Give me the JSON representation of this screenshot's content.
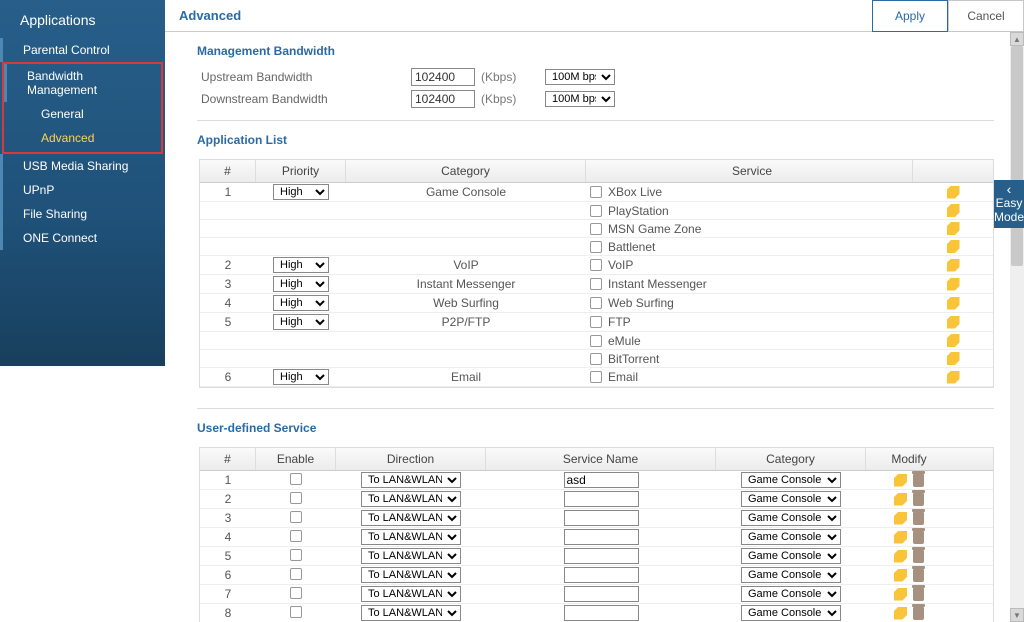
{
  "sidebar": {
    "title": "Applications",
    "items": [
      {
        "label": "Parental Control"
      },
      {
        "label": "Bandwidth Management"
      },
      {
        "label": "General",
        "sub": true
      },
      {
        "label": "Advanced",
        "sub": true,
        "active": true
      },
      {
        "label": "USB Media Sharing"
      },
      {
        "label": "UPnP"
      },
      {
        "label": "File Sharing"
      },
      {
        "label": "ONE Connect"
      }
    ]
  },
  "page": {
    "title": "Advanced",
    "apply": "Apply",
    "cancel": "Cancel"
  },
  "mgmt": {
    "heading": "Management Bandwidth",
    "up_label": "Upstream Bandwidth",
    "down_label": "Downstream Bandwidth",
    "up_value": "102400",
    "down_value": "102400",
    "unit": "(Kbps)",
    "bw_select": "100M bps"
  },
  "applist": {
    "heading": "Application List",
    "cols": {
      "num": "#",
      "prio": "Priority",
      "cat": "Category",
      "srv": "Service",
      "mod": ""
    },
    "priority_value": "High",
    "rows": [
      {
        "num": "1",
        "show_prio": true,
        "cat": "Game Console",
        "srv": "XBox Live"
      },
      {
        "num": "",
        "show_prio": false,
        "cat": "",
        "srv": "PlayStation"
      },
      {
        "num": "",
        "show_prio": false,
        "cat": "",
        "srv": "MSN Game Zone"
      },
      {
        "num": "",
        "show_prio": false,
        "cat": "",
        "srv": "Battlenet"
      },
      {
        "num": "2",
        "show_prio": true,
        "cat": "VoIP",
        "srv": "VoIP"
      },
      {
        "num": "3",
        "show_prio": true,
        "cat": "Instant Messenger",
        "srv": "Instant Messenger"
      },
      {
        "num": "4",
        "show_prio": true,
        "cat": "Web Surfing",
        "srv": "Web Surfing"
      },
      {
        "num": "5",
        "show_prio": true,
        "cat": "P2P/FTP",
        "srv": "FTP"
      },
      {
        "num": "",
        "show_prio": false,
        "cat": "",
        "srv": "eMule"
      },
      {
        "num": "",
        "show_prio": false,
        "cat": "",
        "srv": "BitTorrent"
      },
      {
        "num": "6",
        "show_prio": true,
        "cat": "Email",
        "srv": "Email"
      }
    ]
  },
  "userdef": {
    "heading": "User-defined Service",
    "cols": {
      "num": "#",
      "en": "Enable",
      "dir": "Direction",
      "sname": "Service Name",
      "cat": "Category",
      "mod": "Modify"
    },
    "dir_value": "To LAN&WLAN",
    "cat_value": "Game Console",
    "rows": [
      {
        "num": "1",
        "sname": "asd"
      },
      {
        "num": "2",
        "sname": ""
      },
      {
        "num": "3",
        "sname": ""
      },
      {
        "num": "4",
        "sname": ""
      },
      {
        "num": "5",
        "sname": ""
      },
      {
        "num": "6",
        "sname": ""
      },
      {
        "num": "7",
        "sname": ""
      },
      {
        "num": "8",
        "sname": ""
      }
    ]
  },
  "easy": {
    "line1": "Easy",
    "line2": "Mode"
  }
}
